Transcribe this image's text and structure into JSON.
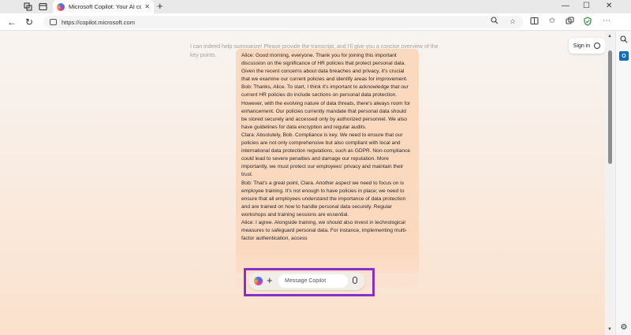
{
  "browser": {
    "tab_title": "Microsoft Copilot: Your AI compa",
    "tab_close": "✕",
    "new_tab": "+",
    "url": "https://copilot.microsoft.com",
    "window_controls": {
      "minimize": "—",
      "maximize": "☐",
      "close": "✕"
    },
    "nav": {
      "back": "←",
      "reload": "↻"
    }
  },
  "page": {
    "faded_message": "I can indeed help summarize! Please provide the transcript, and I'll give you a concise overview of the key points.",
    "sign_in_label": "Sign in",
    "user_message": "Alice: Good morning, everyone. Thank you for joining this important discussion on the significance of HR policies that protect personal data. Given the recent concerns about data breaches and privacy, it's crucial that we examine our current policies and identify areas for improvement.\nBob: Thanks, Alice. To start, I think it's important to acknowledge that our current HR policies do include sections on personal data protection. However, with the evolving nature of data threats, there's always room for enhancement. Our policies currently mandate that personal data should be stored securely and accessed only by authorized personnel. We also have guidelines for data encryption and regular audits.\nClara: Absolutely, Bob. Compliance is key. We need to ensure that our policies are not only comprehensive but also compliant with local and international data protection regulations, such as GDPR. Non-compliance could lead to severe penalties and damage our reputation. More importantly, we must protect our employees' privacy and maintain their trust.\nBob: That's a great point, Clara. Another aspect we need to focus on is employee training. It's not enough to have policies in place; we need to ensure that all employees understand the importance of data protection and are trained on how to handle personal data securely. Regular workshops and training sessions are essential.\nAlice: I agree. Alongside training, we should also invest in technological measures to safeguard personal data. For instance, implementing multi-factor authentication, access",
    "composer": {
      "placeholder": "Message Copilot",
      "plus": "+"
    }
  },
  "colors": {
    "highlight_frame": "#8b2fc9",
    "bubble": "#fbd9bf"
  }
}
